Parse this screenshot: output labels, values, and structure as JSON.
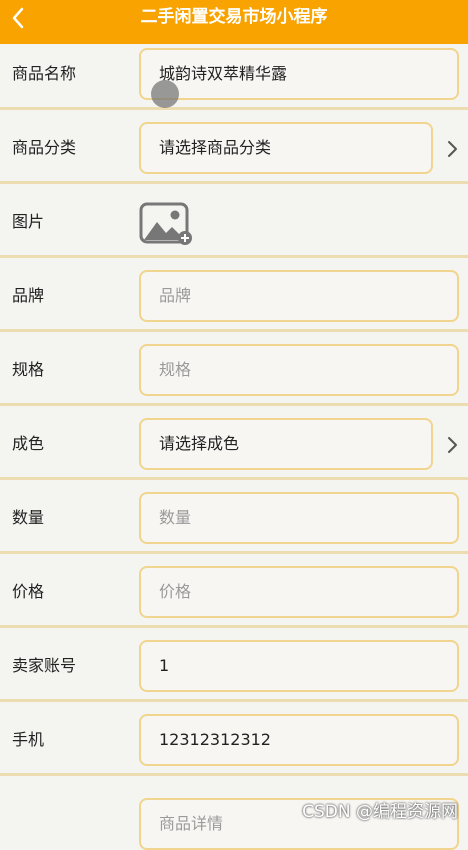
{
  "header": {
    "title": "二手闲置交易市场小程序",
    "back_icon": "chevron-left-icon"
  },
  "colors": {
    "accent": "#f8a300",
    "field_border": "#f1d48e",
    "background": "#f4f4f1"
  },
  "form": {
    "name": {
      "label": "商品名称",
      "value": "城韵诗双萃精华露"
    },
    "category": {
      "label": "商品分类",
      "value": "请选择商品分类"
    },
    "image": {
      "label": "图片",
      "icon": "image-upload-icon"
    },
    "brand": {
      "label": "品牌",
      "placeholder": "品牌"
    },
    "spec": {
      "label": "规格",
      "placeholder": "规格"
    },
    "condition": {
      "label": "成色",
      "value": "请选择成色"
    },
    "quantity": {
      "label": "数量",
      "placeholder": "数量"
    },
    "price": {
      "label": "价格",
      "placeholder": "价格"
    },
    "seller_account": {
      "label": "卖家账号",
      "value": "1"
    },
    "phone": {
      "label": "手机",
      "value": "12312312312"
    },
    "details": {
      "label": "",
      "placeholder": "商品详情"
    }
  },
  "watermark": "CSDN @编程资源网"
}
